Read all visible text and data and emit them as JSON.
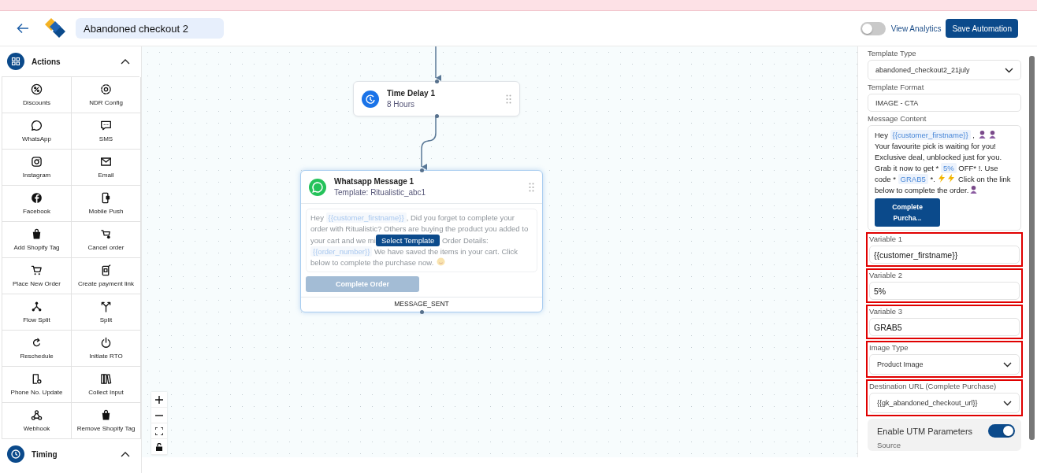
{
  "header": {
    "title": "Abandoned checkout 2",
    "analytics": {
      "label": "View Analytics",
      "on": false
    },
    "save_button": "Save Automation"
  },
  "sidebar": {
    "sections": [
      {
        "title": "Actions",
        "expanded": true,
        "items": [
          "Discounts",
          "NDR Config",
          "WhatsApp",
          "SMS",
          "Instagram",
          "Email",
          "Facebook",
          "Mobile Push",
          "Add Shopify Tag",
          "Cancel order",
          "Place New Order",
          "Create payment link",
          "Flow Split",
          "Split",
          "Reschedule",
          "Initiate RTO",
          "Phone No. Update",
          "Collect Input",
          "Webhook",
          "Remove Shopify Tag"
        ]
      },
      {
        "title": "Timing",
        "expanded": true
      }
    ]
  },
  "canvas": {
    "nodes": [
      {
        "kind": "delay",
        "title": "Time Delay 1",
        "subtitle": "8 Hours"
      },
      {
        "kind": "message",
        "title": "Whatsapp Message 1",
        "subtitle": "Template: Ritualistic_abc1",
        "preview": [
          {
            "kind": "text",
            "text": "Hey "
          },
          {
            "kind": "variable",
            "text": "{{customer_firstname}}"
          },
          {
            "kind": "text",
            "text": ", Did you forget to complete your order with Ritualistic? Others are buying the product you added to your cart and we mi"
          },
          {
            "kind": "button",
            "text": "Select Template"
          },
          {
            "kind": "text",
            "text": " Order Details: "
          },
          {
            "kind": "variable",
            "text": "{{order_number}}"
          },
          {
            "kind": "text",
            "text": " We have saved the items in your cart. Click below to complete the purchase now. "
          },
          {
            "kind": "emoji"
          }
        ],
        "button": "Complete Order",
        "footer": "MESSAGE_SENT"
      }
    ]
  },
  "panel": {
    "fields": [
      {
        "kind": "select",
        "label": "Template Type",
        "value": "abandoned_checkout2_21july",
        "highlighted": false
      },
      {
        "kind": "text",
        "label": "Template Format",
        "value": "IMAGE - CTA",
        "highlighted": false
      },
      {
        "kind": "message",
        "label": "Message Content",
        "highlighted": false,
        "segments": [
          {
            "kind": "text",
            "text": "Hey "
          },
          {
            "kind": "variable",
            "text": "{{customer_firstname}}"
          },
          {
            "kind": "text",
            "text": " , "
          },
          {
            "kind": "emoji"
          },
          {
            "kind": "emoji"
          },
          {
            "kind": "text",
            "text": " Your favourite pick is waiting for you! Exclusive deal, unblocked just for you. Grab it now to get * "
          },
          {
            "kind": "variable",
            "text": "5%"
          },
          {
            "kind": "text",
            "text": " OFF* !. Use code * "
          },
          {
            "kind": "variable",
            "text": "GRAB5"
          },
          {
            "kind": "text",
            "text": " *. "
          },
          {
            "kind": "bolt"
          },
          {
            "kind": "bolt"
          },
          {
            "kind": "text",
            "text": " Click on the link below to complete the order."
          },
          {
            "kind": "emoji"
          }
        ],
        "button": "Complete Purcha..."
      },
      {
        "kind": "text",
        "label": "Variable 1",
        "value": "{{customer_firstname}}",
        "highlighted": true
      },
      {
        "kind": "text",
        "label": "Variable 2",
        "value": "5%",
        "highlighted": true
      },
      {
        "kind": "text",
        "label": "Variable 3",
        "value": "GRAB5",
        "highlighted": true
      },
      {
        "kind": "select",
        "label": "Image Type",
        "value": "Product Image",
        "highlighted": true
      },
      {
        "kind": "select",
        "label": "Destination URL (Complete Purchase)",
        "value": "{{gk_abandoned_checkout_url}}",
        "highlighted": true
      },
      {
        "kind": "toggle",
        "label": "Enable UTM Parameters",
        "on": true,
        "sublabel": "Source",
        "highlighted": false
      }
    ]
  }
}
